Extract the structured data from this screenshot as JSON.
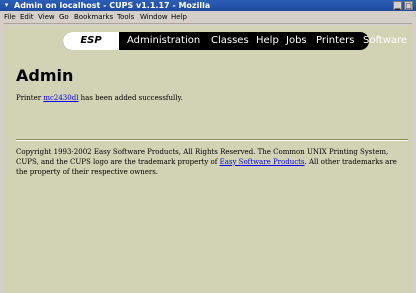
{
  "window": {
    "title": "Admin on localhost - CUPS v1.1.17 - Mozilla",
    "sys_icon": "▾",
    "minimize": "▁",
    "maximize": "□"
  },
  "menu": [
    "File",
    "Edit",
    "View",
    "Go",
    "Bookmarks",
    "Tools",
    "Window",
    "Help"
  ],
  "nav": {
    "logo": "ESP",
    "links": [
      "Administration",
      "Classes",
      "Help",
      "Jobs",
      "Printers",
      "Software"
    ]
  },
  "page": {
    "heading": "Admin",
    "msg_before": "Printer ",
    "printer_link": "mc2430dl",
    "msg_after": " has been added successfully.",
    "copyright_before": "Copyright 1993-2002 Easy Software Products, All Rights Reserved. The Common UNIX Printing System, CUPS, and the CUPS logo are the trademark property of ",
    "copyright_link": "Easy Software Products",
    "copyright_after": ". All other trademarks are the property of their respective owners."
  },
  "colors": {
    "page_background": "#d2d2b4",
    "titlebar": "#1d4aa0",
    "link": "#0000ee"
  }
}
